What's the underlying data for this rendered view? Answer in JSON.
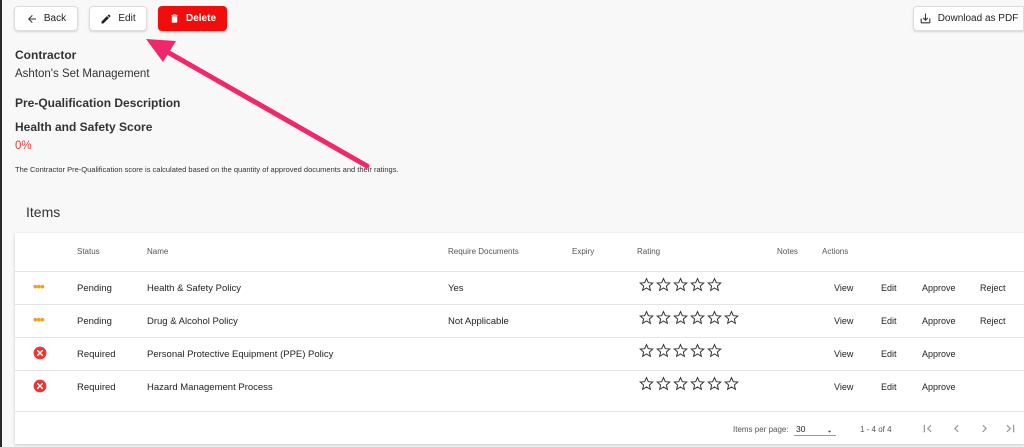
{
  "toolbar": {
    "back_label": "Back",
    "edit_label": "Edit",
    "delete_label": "Delete",
    "download_label": "Download as PDF"
  },
  "details": {
    "contractor_label": "Contractor",
    "contractor_value": "Ashton's Set Management",
    "prequal_label": "Pre-Qualification Description",
    "hs_label": "Health and Safety Score",
    "hs_value": "0%",
    "note": "The Contractor Pre-Qualification score is calculated based on the quantity of approved documents and their ratings."
  },
  "items": {
    "title": "Items",
    "headers": [
      "Status",
      "Name",
      "Require Documents",
      "Expiry",
      "Rating",
      "Notes",
      "Actions"
    ],
    "rows": [
      {
        "status": "Pending",
        "name": "Health & Safety Policy",
        "require": "Yes",
        "expiry": "",
        "stars": 0,
        "icon": "pending-dots-icon",
        "view": "View",
        "edit": "Edit",
        "approve": "Approve",
        "reject": "Reject"
      },
      {
        "status": "Pending",
        "name": "Drug & Alcohol Policy",
        "require": "Not Applicable",
        "expiry": "",
        "stars": 0,
        "icon": "pending-dots-icon",
        "view": "View",
        "edit": "Edit",
        "approve": "Approve",
        "reject": "Reject"
      },
      {
        "status": "Required",
        "name": "Personal Protective Equipment (PPE) Policy",
        "require": "",
        "expiry": "",
        "stars": 0,
        "icon": "error-circle-icon",
        "view": "View",
        "edit": "Edit",
        "approve": "Approve",
        "reject": ""
      },
      {
        "status": "Required",
        "name": "Hazard Management Process",
        "require": "",
        "expiry": "",
        "stars": 0,
        "icon": "error-circle-icon",
        "view": "View",
        "edit": "Edit",
        "approve": "Approve",
        "reject": ""
      }
    ],
    "footer": {
      "items_per_page_label": "Items per page:",
      "page_size": "30",
      "range": "1 - 4 of 4"
    }
  },
  "colors": {
    "delete": "#f20d0d",
    "error": "#e53935",
    "pending": "#f29b1d",
    "score": "#e53935",
    "annotation_arrow": "#f0286a"
  }
}
